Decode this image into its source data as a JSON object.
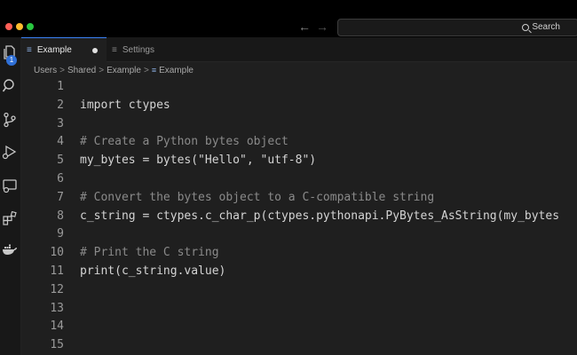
{
  "window": {
    "search_label": "Search",
    "back_arrow": "←",
    "forward_arrow": "→"
  },
  "activity_bar": {
    "icons": [
      "files-icon",
      "search-icon",
      "source-control-icon",
      "run-debug-icon",
      "remote-explorer-icon",
      "extensions-icon",
      "docker-icon"
    ],
    "files_badge": "1"
  },
  "tabs": [
    {
      "label": "Example",
      "icon": "≡",
      "active": true,
      "dirty": true
    },
    {
      "label": "Settings",
      "icon": "≡",
      "active": false,
      "dirty": false
    }
  ],
  "breadcrumb": {
    "items": [
      "Users",
      "Shared",
      "Example",
      "Example"
    ],
    "separator": ">"
  },
  "editor": {
    "lines": [
      {
        "n": "1",
        "text": "",
        "type": "code"
      },
      {
        "n": "2",
        "text": "import ctypes",
        "type": "code"
      },
      {
        "n": "3",
        "text": "",
        "type": "code"
      },
      {
        "n": "4",
        "text": "# Create a Python bytes object",
        "type": "comment"
      },
      {
        "n": "5",
        "text": "my_bytes = bytes(\"Hello\", \"utf-8\")",
        "type": "code"
      },
      {
        "n": "6",
        "text": "",
        "type": "code"
      },
      {
        "n": "7",
        "text": "# Convert the bytes object to a C-compatible string",
        "type": "comment"
      },
      {
        "n": "8",
        "text": "c_string = ctypes.c_char_p(ctypes.pythonapi.PyBytes_AsString(my_bytes",
        "type": "code"
      },
      {
        "n": "9",
        "text": "",
        "type": "code"
      },
      {
        "n": "10",
        "text": "# Print the C string",
        "type": "comment"
      },
      {
        "n": "11",
        "text": "print(c_string.value)",
        "type": "code"
      },
      {
        "n": "12",
        "text": "",
        "type": "code"
      },
      {
        "n": "13",
        "text": "",
        "type": "code"
      },
      {
        "n": "14",
        "text": "",
        "type": "code"
      },
      {
        "n": "15",
        "text": "",
        "type": "code"
      }
    ]
  },
  "colors": {
    "accent": "#3b82f6",
    "badge": "#2f6fd6",
    "editor_bg": "#1f1f1f",
    "comment": "#8a8a8a"
  }
}
